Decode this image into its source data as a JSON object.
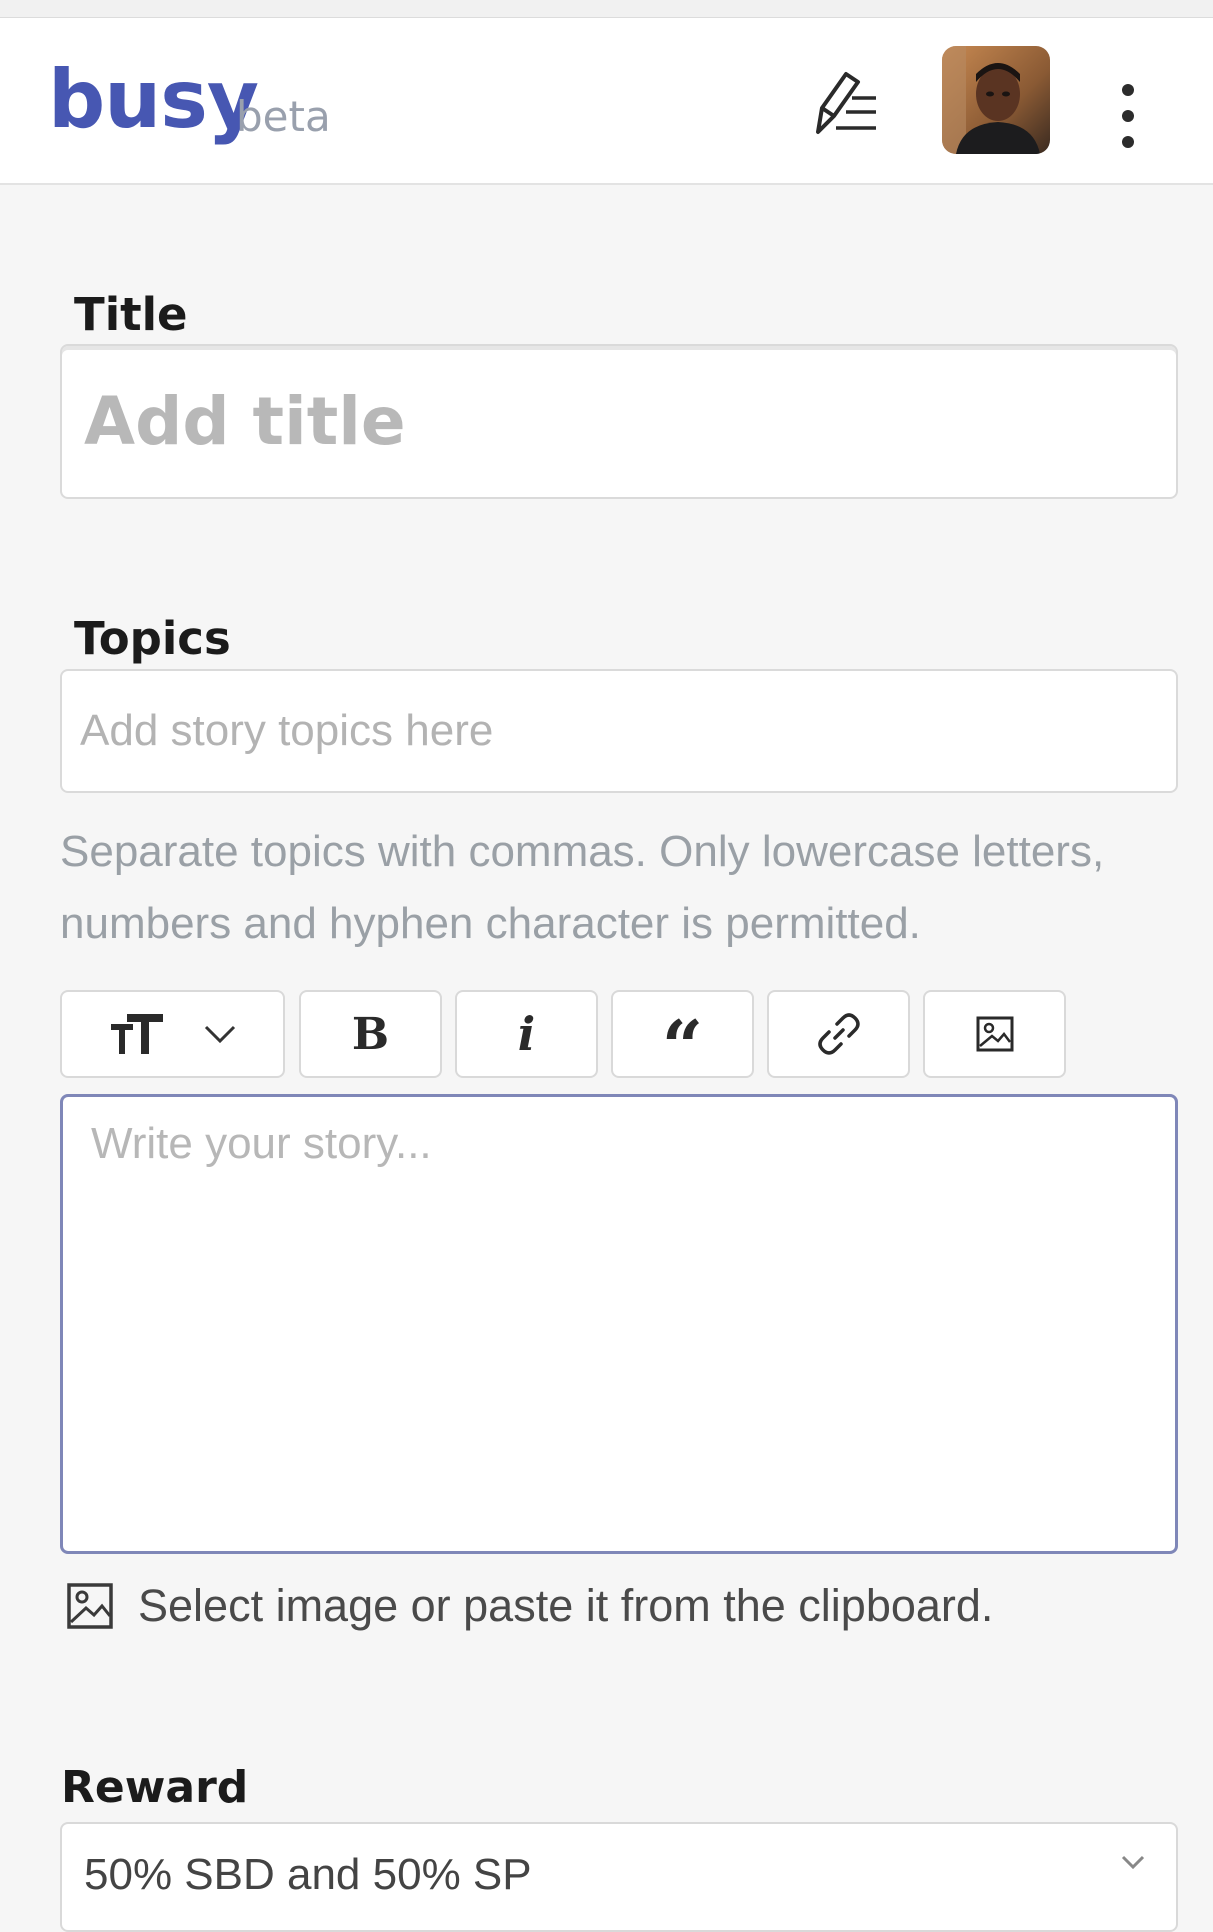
{
  "header": {
    "logo": "busy",
    "logo_badge": "beta",
    "write_icon": "write-post-icon",
    "avatar_alt": "user-avatar",
    "more_icon": "more-vertical-icon"
  },
  "editor": {
    "title_label": "Title",
    "title_placeholder": "Add title",
    "topics_label": "Topics",
    "topics_placeholder": "Add story topics here",
    "topics_hint": "Separate topics with commas. Only lowercase letters, numbers and hyphen character is permitted.",
    "toolbar": {
      "heading_icon": "text-size-icon",
      "bold_label": "B",
      "italic_label": "i",
      "quote_label": "“",
      "link_icon": "link-icon",
      "image_icon": "image-icon"
    },
    "body_placeholder": "Write your story...",
    "upload_text": "Select image or paste it from the clipboard.",
    "reward_label": "Reward",
    "reward_value": "50% SBD and 50% SP"
  },
  "colors": {
    "brand": "#4757b2",
    "focus_border": "#7f87b8",
    "background": "#f6f6f6"
  }
}
